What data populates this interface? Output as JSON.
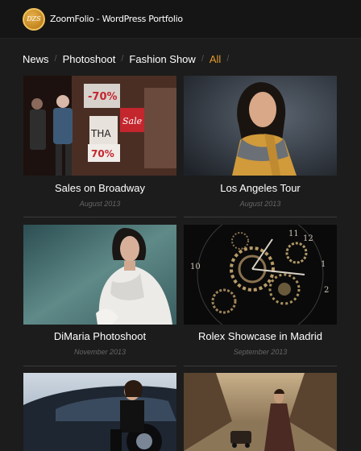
{
  "header": {
    "logo_text": "DZS",
    "site_title": "ZoomFolio - WordPress Portfolio"
  },
  "filters": [
    "News",
    "Photoshoot",
    "Fashion Show",
    "All"
  ],
  "active_filter": "All",
  "portfolio": [
    {
      "title": "Sales on Broadway",
      "date": "August 2013"
    },
    {
      "title": "Los Angeles Tour",
      "date": "August 2013"
    },
    {
      "title": "DiMaria Photoshoot",
      "date": "November 2013"
    },
    {
      "title": "Rolex Showcase in Madrid",
      "date": "September 2013"
    },
    {
      "title": "",
      "date": ""
    },
    {
      "title": "",
      "date": ""
    }
  ],
  "accent_color": "#e39a2d"
}
